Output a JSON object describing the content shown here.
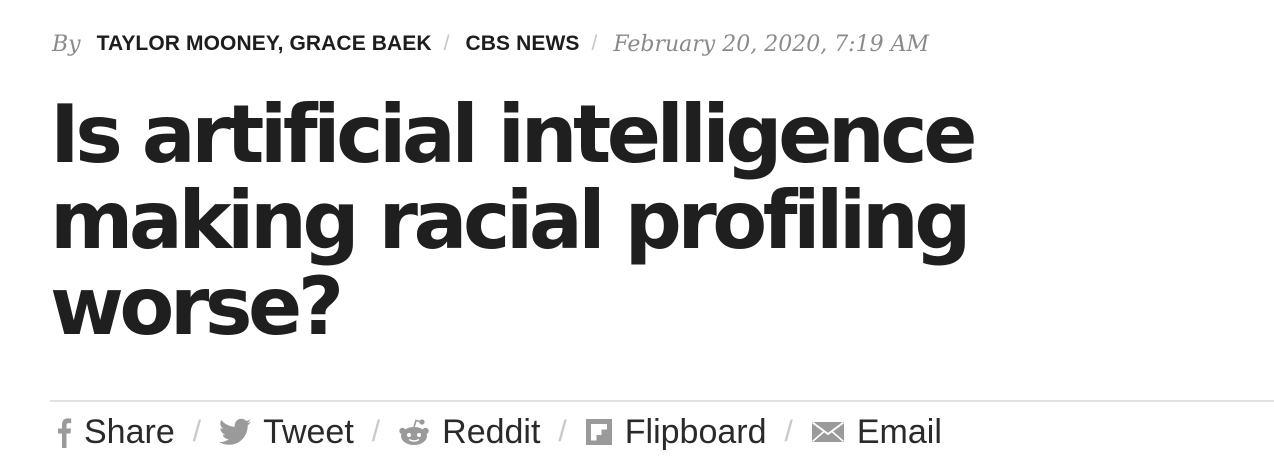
{
  "byline": {
    "by_label": "By",
    "authors": "TAYLOR MOONEY, GRACE BAEK",
    "separator": "/",
    "source": "CBS NEWS",
    "date": "February 20, 2020, 7:19 AM"
  },
  "headline": "Is artificial intelligence making racial profiling worse?",
  "share": {
    "separator": "/",
    "items": [
      {
        "label": "Share",
        "icon": "facebook-icon"
      },
      {
        "label": "Tweet",
        "icon": "twitter-icon"
      },
      {
        "label": "Reddit",
        "icon": "reddit-icon"
      },
      {
        "label": "Flipboard",
        "icon": "flipboard-icon"
      },
      {
        "label": "Email",
        "icon": "email-icon"
      }
    ]
  },
  "colors": {
    "text": "#1f1f1f",
    "muted": "#8a8a8a",
    "icon": "#9a9a9a",
    "rule": "#e2e2e2"
  }
}
